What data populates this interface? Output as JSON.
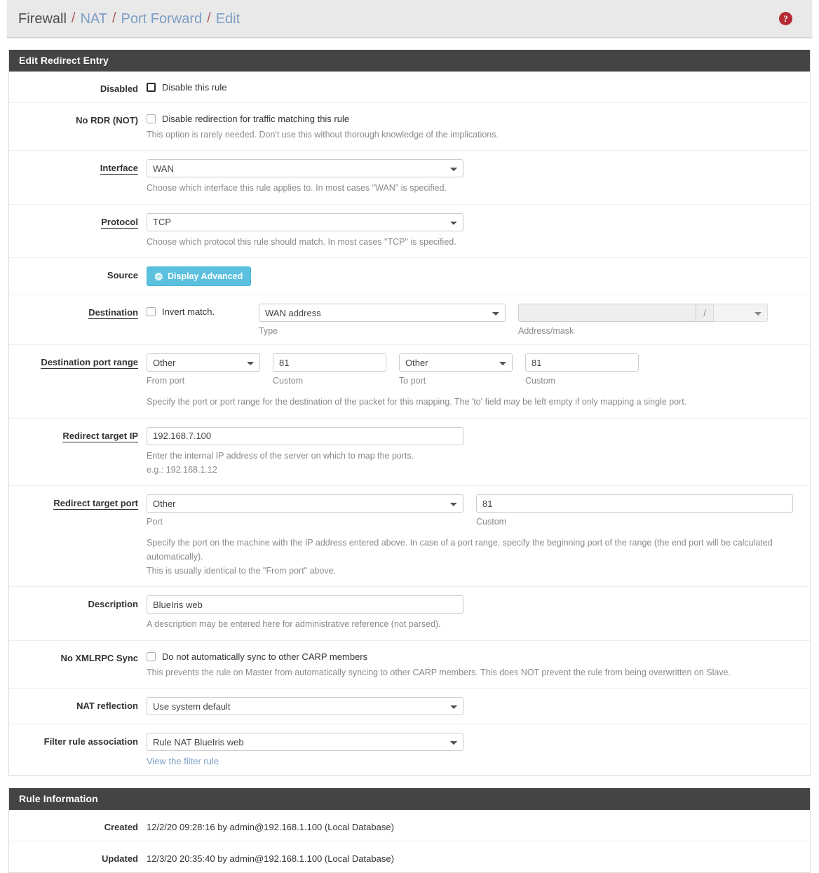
{
  "breadcrumb": {
    "items": [
      {
        "label": "Firewall",
        "link": false
      },
      {
        "label": "NAT",
        "link": true
      },
      {
        "label": "Port Forward",
        "link": true
      },
      {
        "label": "Edit",
        "link": true
      }
    ],
    "separator": "/",
    "help_icon": "help-circle-icon",
    "help_glyph": "?"
  },
  "colors": {
    "header_bg": "#444444",
    "breadcrumb_bg": "#e9e9e9",
    "link": "#7c9ec4",
    "separator": "#b05a5a",
    "help_badge": "#b52b33",
    "info_button": "#5bc0de"
  },
  "edit_panel": {
    "title": "Edit Redirect Entry",
    "disabled": {
      "label": "Disabled",
      "checkbox_label": "Disable this rule",
      "checked": false,
      "focused": true
    },
    "no_rdr": {
      "label": "No RDR (NOT)",
      "checkbox_label": "Disable redirection for traffic matching this rule",
      "checked": false,
      "help": "This option is rarely needed. Don't use this without thorough knowledge of the implications."
    },
    "interface": {
      "label": "Interface",
      "value": "WAN",
      "help": "Choose which interface this rule applies to. In most cases \"WAN\" is specified."
    },
    "protocol": {
      "label": "Protocol",
      "value": "TCP",
      "help": "Choose which protocol this rule should match. In most cases \"TCP\" is specified."
    },
    "source": {
      "label": "Source",
      "button_label": "Display Advanced",
      "button_icon": "gear-icon"
    },
    "destination": {
      "label": "Destination",
      "invert_label": "Invert match.",
      "invert_checked": false,
      "type_value": "WAN address",
      "type_sublabel": "Type",
      "address_value": "",
      "address_placeholder": "",
      "address_disabled": true,
      "slash": "/",
      "mask_value": "",
      "address_sublabel": "Address/mask"
    },
    "dest_port_range": {
      "label": "Destination port range",
      "from_port_value": "Other",
      "from_port_sublabel": "From port",
      "from_custom_value": "81",
      "from_custom_sublabel": "Custom",
      "to_port_value": "Other",
      "to_port_sublabel": "To port",
      "to_custom_value": "81",
      "to_custom_sublabel": "Custom",
      "help": "Specify the port or port range for the destination of the packet for this mapping. The 'to' field may be left empty if only mapping a single port."
    },
    "redirect_target_ip": {
      "label": "Redirect target IP",
      "value": "192.168.7.100",
      "help_line1": "Enter the internal IP address of the server on which to map the ports.",
      "help_line2": "e.g.: 192.168.1.12"
    },
    "redirect_target_port": {
      "label": "Redirect target port",
      "port_value": "Other",
      "port_sublabel": "Port",
      "custom_value": "81",
      "custom_sublabel": "Custom",
      "help_line1": "Specify the port on the machine with the IP address entered above. In case of a port range, specify the beginning port of the range (the end port will be calculated automatically).",
      "help_line2": "This is usually identical to the \"From port\" above."
    },
    "description": {
      "label": "Description",
      "value": "BlueIris web",
      "help": "A description may be entered here for administrative reference (not parsed)."
    },
    "no_xmlrpc_sync": {
      "label": "No XMLRPC Sync",
      "checkbox_label": "Do not automatically sync to other CARP members",
      "checked": false,
      "help": "This prevents the rule on Master from automatically syncing to other CARP members. This does NOT prevent the rule from being overwritten on Slave."
    },
    "nat_reflection": {
      "label": "NAT reflection",
      "value": "Use system default"
    },
    "filter_rule_association": {
      "label": "Filter rule association",
      "value": "Rule NAT BlueIris web",
      "link_label": "View the filter rule"
    }
  },
  "rule_information": {
    "title": "Rule Information",
    "rows": [
      {
        "label": "Created",
        "value": "12/2/20 09:28:16 by admin@192.168.1.100 (Local Database)"
      },
      {
        "label": "Updated",
        "value": "12/3/20 20:35:40 by admin@192.168.1.100 (Local Database)"
      }
    ]
  }
}
